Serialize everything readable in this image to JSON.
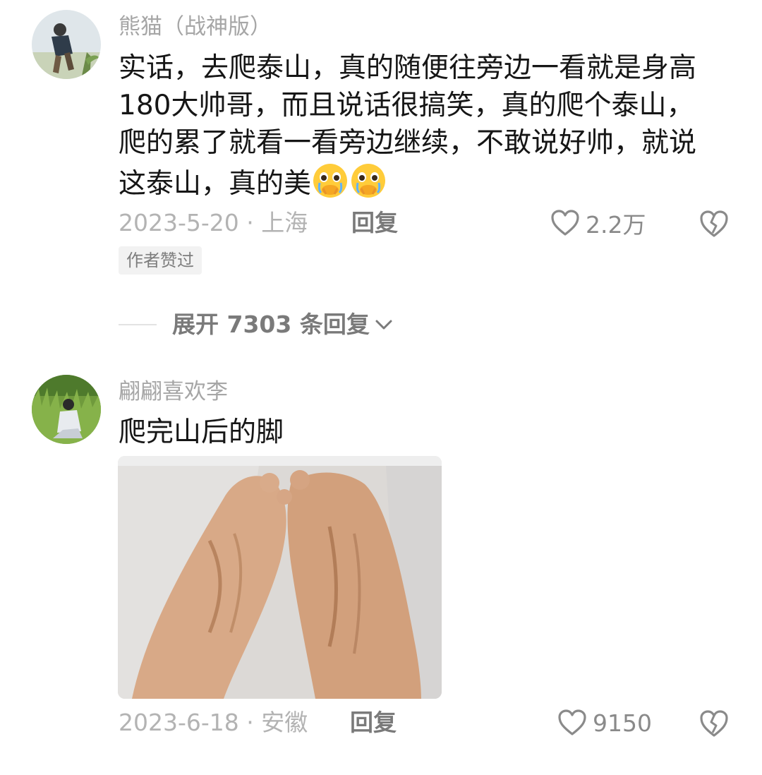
{
  "comments": [
    {
      "username": "熊猫（战神版）",
      "text": "实话，去爬泰山，真的随便往旁边一看就是身高180大帅哥，而且说话很搞笑，真的爬个泰山，爬的累了就看一看旁边继续，不敢说好帅，就说这泰山，真的美",
      "emojis": [
        "crying-face-emoji",
        "crying-face-emoji"
      ],
      "date_location": "2023-5-20 · 上海",
      "reply_label": "回复",
      "like_count": "2.2万",
      "badge": "作者赞过",
      "expand_label": "展开 7303 条回复"
    },
    {
      "username": "翩翩喜欢李",
      "text": "爬完山后的脚",
      "date_location": "2023-6-18 · 安徽",
      "reply_label": "回复",
      "like_count": "9150"
    }
  ],
  "colors": {
    "username": "#a6a6a6",
    "text": "#161616",
    "meta": "#b3b3b3",
    "action": "#7a7a7a"
  },
  "icons": [
    "heart-outline-icon",
    "broken-heart-icon",
    "chevron-down-icon"
  ]
}
